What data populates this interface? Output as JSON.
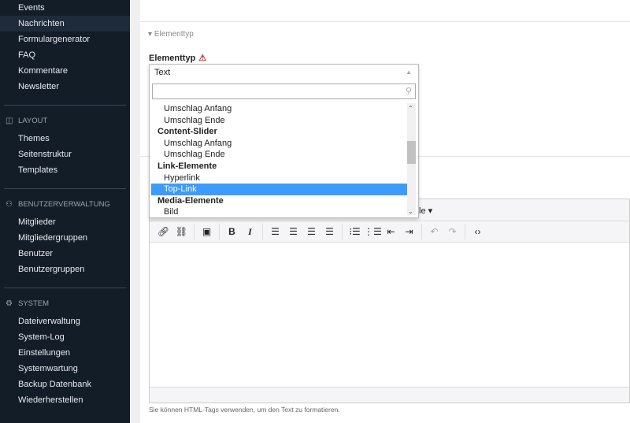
{
  "sidebar": {
    "top_items": [
      {
        "label": "Events"
      },
      {
        "label": "Nachrichten",
        "active": true
      },
      {
        "label": "Formulargenerator"
      },
      {
        "label": "FAQ"
      },
      {
        "label": "Kommentare"
      },
      {
        "label": "Newsletter"
      }
    ],
    "sections": [
      {
        "title": "LAYOUT",
        "icon": "layout-icon",
        "items": [
          "Themes",
          "Seitenstruktur",
          "Templates"
        ]
      },
      {
        "title": "BENUTZERVERWALTUNG",
        "icon": "user-icon",
        "items": [
          "Mitglieder",
          "Mitgliedergruppen",
          "Benutzer",
          "Benutzergruppen"
        ]
      },
      {
        "title": "SYSTEM",
        "icon": "gear-icon",
        "items": [
          "Dateiverwaltung",
          "System-Log",
          "Einstellungen",
          "Systemwartung",
          "Backup Datenbank",
          "Wiederherstellen"
        ]
      }
    ]
  },
  "main": {
    "section_title": "Elementtyp",
    "field_label": "Elementtyp",
    "select": {
      "value": "Text",
      "search_value": "",
      "options": [
        {
          "type": "opt",
          "label": "Umschlag Anfang"
        },
        {
          "type": "opt",
          "label": "Umschlag Ende"
        },
        {
          "type": "grp",
          "label": "Content-Slider"
        },
        {
          "type": "opt",
          "label": "Umschlag Anfang"
        },
        {
          "type": "opt",
          "label": "Umschlag Ende"
        },
        {
          "type": "grp",
          "label": "Link-Elemente"
        },
        {
          "type": "opt",
          "label": "Hyperlink"
        },
        {
          "type": "opt",
          "label": "Top-Link",
          "highlighted": true
        },
        {
          "type": "grp",
          "label": "Media-Elemente"
        },
        {
          "type": "opt",
          "label": "Bild"
        }
      ]
    },
    "editor": {
      "style_menu_visible": "le ▾",
      "toolbar": [
        "link-icon",
        "unlink-icon",
        "|",
        "image-icon",
        "|",
        "bold-icon",
        "italic-icon",
        "|",
        "align-left-icon",
        "align-center-icon",
        "align-right-icon",
        "align-justify-icon",
        "|",
        "bullet-list-icon",
        "numbered-list-icon",
        "outdent-icon",
        "indent-icon",
        "|",
        "undo-icon",
        "redo-icon",
        "|",
        "code-icon"
      ]
    },
    "help_text": "Sie können HTML-Tags verwenden, um den Text zu formatieren."
  },
  "colors": {
    "sidebar_bg": "#131d28",
    "highlight": "#3d9bff",
    "warning": "#c62828"
  }
}
